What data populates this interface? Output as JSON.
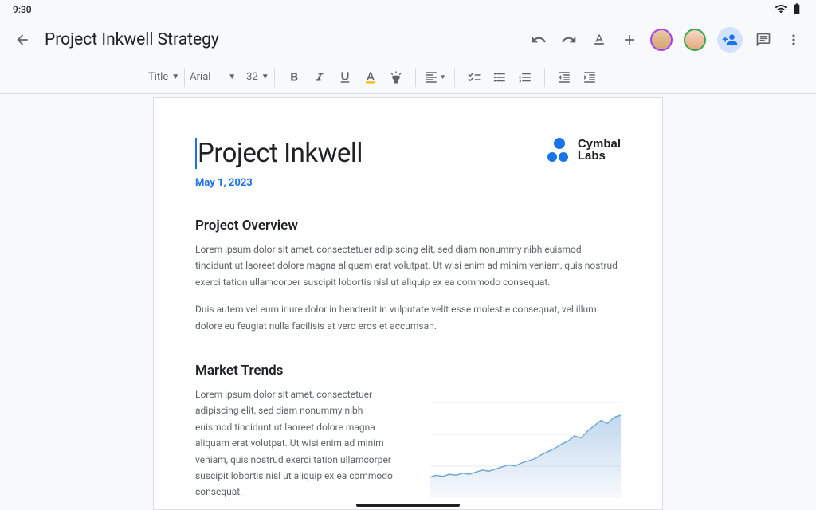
{
  "status": {
    "time": "9:30"
  },
  "header": {
    "doc_title": "Project Inkwell Strategy"
  },
  "toolbar": {
    "style_select": "Title",
    "font_select": "Arial",
    "size_select": "32"
  },
  "document": {
    "title": "Project Inkwell",
    "date": "May 1, 2023",
    "logo_line1": "Cymbal",
    "logo_line2": "Labs",
    "section1_heading": "Project Overview",
    "section1_p1": "Lorem ipsum dolor sit amet, consectetuer adipiscing elit, sed diam nonummy nibh euismod tincidunt ut laoreet dolore magna aliquam erat volutpat. Ut wisi enim ad minim veniam, quis nostrud exerci tation ullamcorper suscipit lobortis nisl ut aliquip ex ea commodo consequat.",
    "section1_p2": "Duis autem vel eum iriure dolor in hendrerit in vulputate velit esse molestie consequat, vel illum dolore eu feugiat nulla facilisis at vero eros et accumsan.",
    "section2_heading": "Market Trends",
    "section2_p1": "Lorem ipsum dolor sit amet, consectetuer adipiscing elit, sed diam nonummy nibh euismod tincidunt ut laoreet dolore magna aliquam erat volutpat. Ut wisi enim ad minim veniam, quis nostrud exerci tation ullamcorper suscipit lobortis nisl ut aliquip ex ea commodo consequat."
  },
  "chart_data": {
    "type": "area",
    "title": "",
    "xlabel": "",
    "ylabel": "",
    "x": [
      0,
      1,
      2,
      3,
      4,
      5,
      6,
      7,
      8,
      9,
      10,
      11,
      12,
      13,
      14,
      15,
      16,
      17,
      18,
      19,
      20,
      21,
      22,
      23,
      24,
      25,
      26,
      27,
      28,
      29
    ],
    "values": [
      20,
      22,
      21,
      23,
      22,
      24,
      23,
      25,
      27,
      26,
      28,
      30,
      32,
      31,
      34,
      36,
      38,
      42,
      45,
      48,
      52,
      55,
      60,
      58,
      65,
      70,
      75,
      72,
      78,
      80
    ],
    "ylim": [
      0,
      100
    ]
  }
}
